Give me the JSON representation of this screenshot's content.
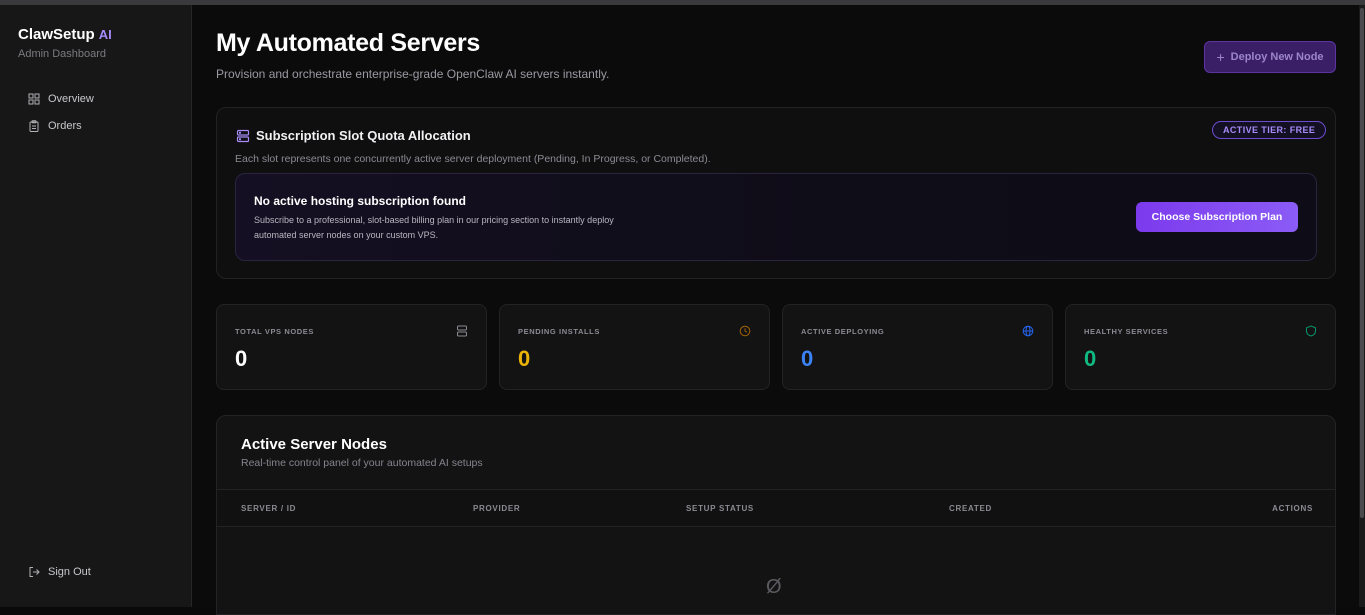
{
  "sidebar": {
    "brand": "ClawSetup",
    "brand_suffix": "AI",
    "subtitle": "Admin Dashboard",
    "items": [
      {
        "label": "Overview",
        "icon": "grid-icon"
      },
      {
        "label": "Orders",
        "icon": "clipboard-icon"
      }
    ],
    "signout": {
      "label": "Sign Out",
      "icon": "logout-icon"
    }
  },
  "header": {
    "title": "My Automated Servers",
    "subtitle": "Provision and orchestrate enterprise-grade OpenClaw AI servers instantly.",
    "deploy_button": "Deploy New Node"
  },
  "quota": {
    "title": "Subscription Slot Quota Allocation",
    "description": "Each slot represents one concurrently active server deployment (Pending, In Progress, or Completed).",
    "tier_badge": "ACTIVE TIER: FREE",
    "notice_title": "No active hosting subscription found",
    "notice_text": "Subscribe to a professional, slot-based billing plan in our pricing section to instantly deploy automated server nodes on your custom VPS.",
    "choose_button": "Choose Subscription Plan"
  },
  "stats": [
    {
      "label": "TOTAL VPS NODES",
      "value": "0",
      "color": "#ffffff",
      "icon": "server-icon"
    },
    {
      "label": "PENDING INSTALLS",
      "value": "0",
      "color": "#eab308",
      "icon": "clock-icon"
    },
    {
      "label": "ACTIVE DEPLOYING",
      "value": "0",
      "color": "#3b82f6",
      "icon": "globe-icon"
    },
    {
      "label": "HEALTHY SERVICES",
      "value": "0",
      "color": "#10b981",
      "icon": "shield-icon"
    }
  ],
  "nodes": {
    "title": "Active Server Nodes",
    "subtitle": "Real-time control panel of your automated AI setups",
    "columns": [
      "SERVER / ID",
      "PROVIDER",
      "SETUP STATUS",
      "CREATED",
      "ACTIONS"
    ],
    "empty_glyph": "Ø"
  },
  "colors": {
    "accent": "#8b5cf6",
    "background": "#0b0b0c",
    "sidebar": "#171717"
  }
}
